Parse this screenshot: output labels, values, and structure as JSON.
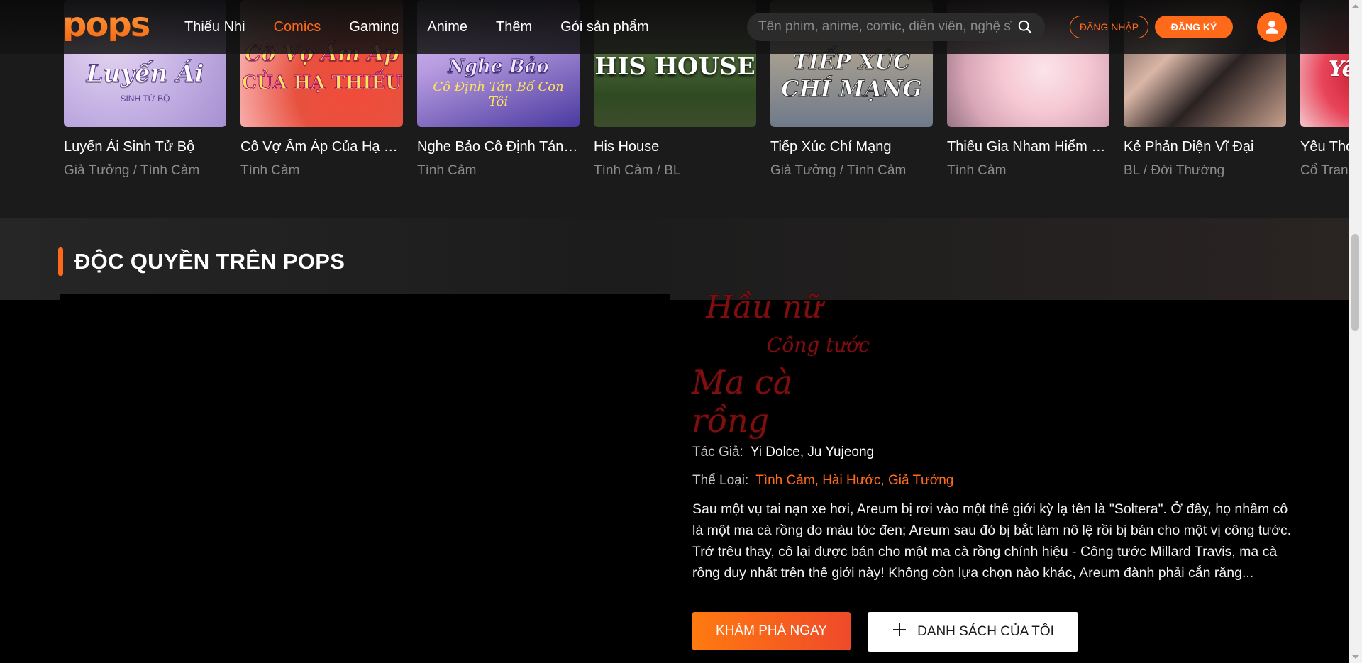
{
  "brand": {
    "logo_text": "pops",
    "accent": "#ff6a1a"
  },
  "nav": {
    "items": [
      {
        "label": "Thiếu Nhi",
        "active": false
      },
      {
        "label": "Comics",
        "active": true
      },
      {
        "label": "Gaming",
        "active": false
      },
      {
        "label": "Anime",
        "active": false
      },
      {
        "label": "Thêm",
        "active": false
      },
      {
        "label": "Gói sản phẩm",
        "active": false
      }
    ]
  },
  "search": {
    "placeholder": "Tên phim, anime, comic, diễn viên, nghệ sĩ",
    "icon": "search-icon"
  },
  "auth": {
    "login_label": "ĐĂNG NHẬP",
    "register_label": "ĐĂNG KÝ",
    "avatar_icon": "user-icon"
  },
  "cards": [
    {
      "title": "Luyến Ái Sinh Tử Bộ",
      "genre": "Giả Tưởng / Tình Cảm",
      "cover_text": "Luyến Ái",
      "cover_sub": "SINH TỬ BỘ"
    },
    {
      "title": "Cô Vợ Ấm Áp Của Hạ Thiếu",
      "genre": "Tình Cảm",
      "cover_text": "Cô Vợ Ấm Áp",
      "cover_sub": "CỦA HẠ THIẾU"
    },
    {
      "title": "Nghe Bảo Cô Định Tán Bố Con Tôi",
      "genre": "Tình Cảm",
      "cover_text": "Nghe Bảo",
      "cover_sub": "Cô Định Tán Bố Con Tôi"
    },
    {
      "title": "His House",
      "genre": "Tình Cảm / BL",
      "cover_text": "HIS HOUSE",
      "cover_sub": ""
    },
    {
      "title": "Tiếp Xúc Chí Mạng",
      "genre": "Giả Tưởng / Tình Cảm",
      "cover_text": "TIẾP XÚC",
      "cover_sub": "CHÍ MẠNG"
    },
    {
      "title": "Thiếu Gia Nham Hiểm Và Cô Vợ",
      "genre": "Tình Cảm",
      "cover_text": "",
      "cover_sub": ""
    },
    {
      "title": "Kẻ Phản Diện Vĩ Đại",
      "genre": "BL / Đời Thường",
      "cover_text": "",
      "cover_sub": ""
    },
    {
      "title": "Yêu Thọ",
      "genre": "Cổ Trang",
      "cover_text": "Yê",
      "cover_sub": ""
    }
  ],
  "exclusive": {
    "heading": "ĐỘC QUYỀN TRÊN POPS",
    "logo": {
      "line1": "Hầu nữ",
      "line2": "Công tước",
      "line3": "Ma cà rồng"
    },
    "author_label": "Tác Giả:",
    "author_value": "Yi Dolce, Ju Yujeong",
    "genre_label": "Thể Loại:",
    "genre_value": "Tình Cảm, Hài Hước, Giả Tưởng",
    "description": "Sau một vụ tai nạn xe hơi, Areum bị rơi vào một thế giới kỳ lạ tên là \"Soltera\". Ở đây, họ nhầm cô là một ma cà rồng do màu tóc đen; Areum sau đó bị bắt làm nô lệ rồi bị bán cho một vị công tước. Trớ trêu thay, cô lại được bán cho một ma cà rồng chính hiệu - Công tước Millard Travis, ma cà rồng duy nhất trên thế giới này! Không còn lựa chọn nào khác, Areum đành phải cắn răng...",
    "explore_label": "KHÁM PHÁ NGAY",
    "mylist_label": "DANH SÁCH CỦA TÔI"
  }
}
